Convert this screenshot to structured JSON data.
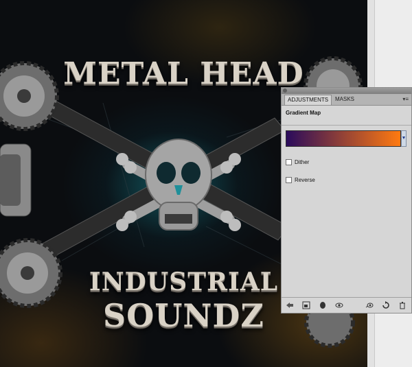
{
  "artwork": {
    "title_top": "METAL HEAD",
    "title_mid": "INDUSTRIAL",
    "title_bot": "SOUNDZ"
  },
  "panel": {
    "tabs": [
      {
        "label": "ADJUSTMENTS",
        "active": true
      },
      {
        "label": "MASKS",
        "active": false
      }
    ],
    "menu_glyph": "▾≡",
    "heading": "Gradient Map",
    "gradient": {
      "start_color": "#2a0b5c",
      "end_color": "#ff7a10"
    },
    "dither_label": "Dither",
    "reverse_label": "Reverse",
    "dither_checked": false,
    "reverse_checked": false,
    "footer_icons": [
      "back-arrow-icon",
      "panel-view-icon",
      "clip-layer-icon",
      "visibility-eye-icon",
      "previous-state-icon",
      "reset-icon",
      "trash-icon"
    ]
  },
  "colors": {
    "panel_bg": "#d6d6d6",
    "canvas_bg": "#0b0d10",
    "teal_glow": "#146e78",
    "title_color": "#d9d2c6"
  }
}
